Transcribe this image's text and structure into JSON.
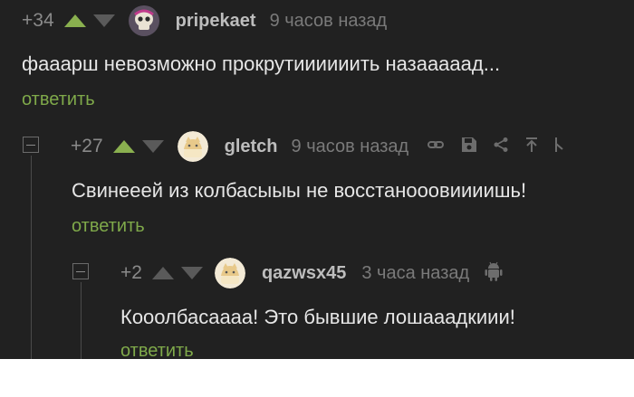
{
  "comments": [
    {
      "rating": "+34",
      "username": "pripekaet",
      "time": "9 часов назад",
      "text": "фааарш невозможно прокрутиииииить назааааад...",
      "reply_label": "ответить",
      "avatar": "skull-avatar"
    },
    {
      "rating": "+27",
      "username": "gletch",
      "time": "9 часов назад",
      "text": "Свинееей из колбасыыы не восстанооовиииишь!",
      "reply_label": "ответить",
      "avatar": "cat-avatar",
      "tools": [
        "link-icon",
        "save-icon",
        "share-icon",
        "scroll-up-icon",
        "branch-icon"
      ]
    },
    {
      "rating": "+2",
      "username": "qazwsx45",
      "time": "3 часа назад",
      "text": "Кооолбасаааа! Это бывшие лошааадкиии!",
      "reply_label": "ответить",
      "avatar": "cat-avatar",
      "platform_icon": "android-icon"
    }
  ],
  "colors": {
    "background": "#212121",
    "upvote": "#8ab04f",
    "reply_link": "#7fa94a",
    "text": "#e6e6e6",
    "meta": "#7a7a7a"
  }
}
